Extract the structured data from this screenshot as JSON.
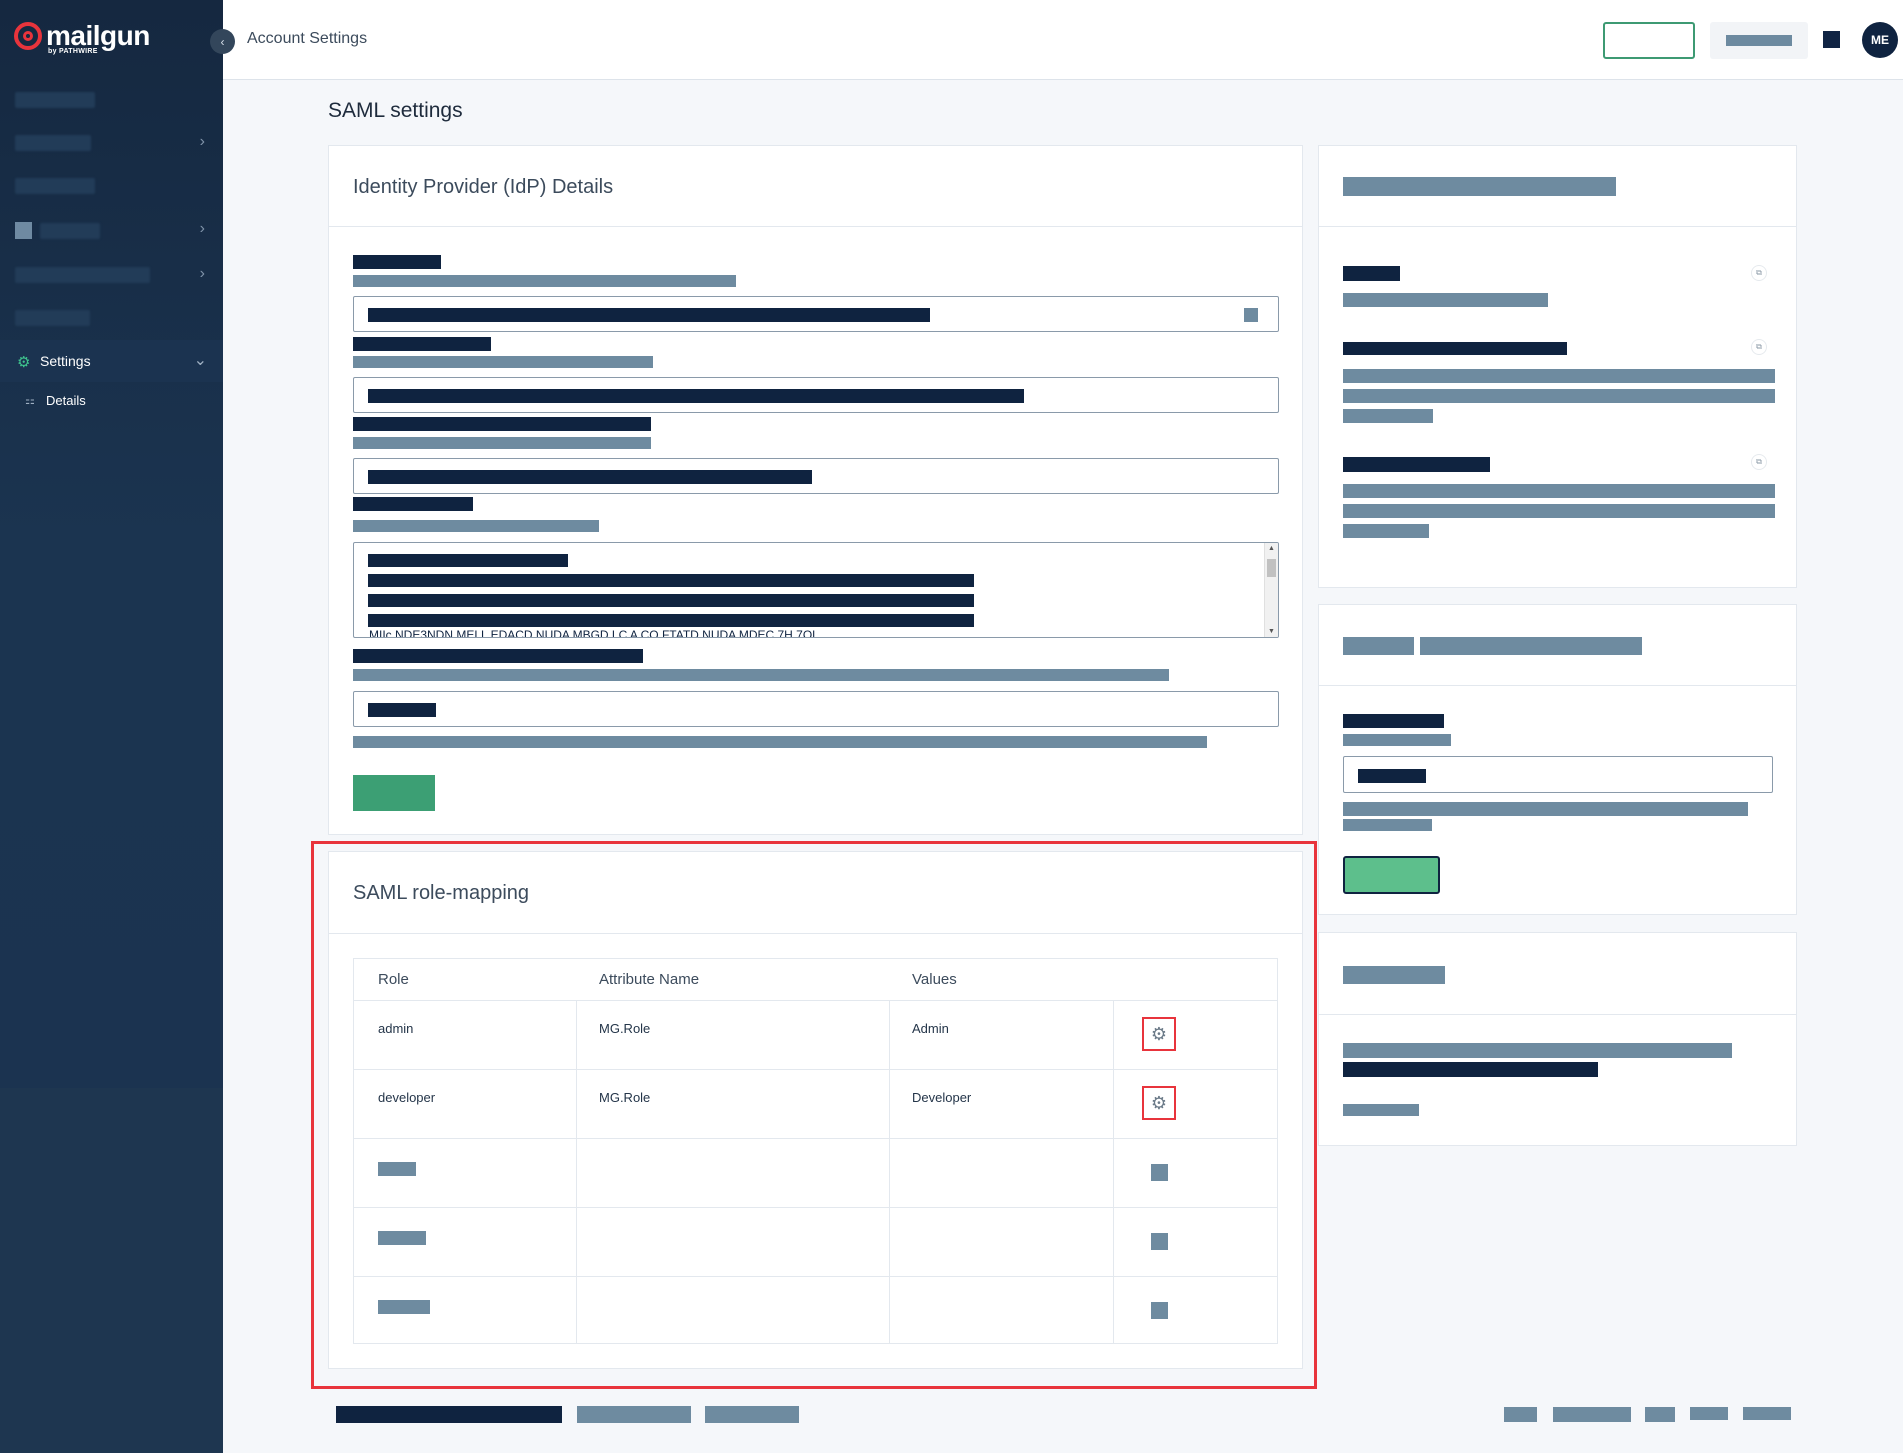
{
  "app": {
    "logo_text": "mailgun",
    "logo_sub": "by PATHWIRE"
  },
  "header": {
    "breadcrumb": "Account Settings",
    "avatar_initials": "ME"
  },
  "sidebar": {
    "settings_label": "Settings",
    "details_label": "Details"
  },
  "page": {
    "title": "SAML settings"
  },
  "idp_card": {
    "title": "Identity Provider (IdP) Details",
    "textarea_cut_text": "MIIc NDE3NDN MELL EDACD NUDA MBGD LC A CO FTATD NUDA MDEC 7H 7OL"
  },
  "role_mapping": {
    "title": "SAML role-mapping",
    "columns": [
      "Role",
      "Attribute Name",
      "Values"
    ],
    "rows": [
      {
        "role": "admin",
        "attribute": "MG.Role",
        "value": "Admin"
      },
      {
        "role": "developer",
        "attribute": "MG.Role",
        "value": "Developer"
      }
    ]
  },
  "icons": {
    "gear": "gear-icon",
    "copy": "copy-icon",
    "chevron": "chevron-right-icon"
  },
  "colors": {
    "sidebar": "#1e3650",
    "accent_green": "#3c9f74",
    "highlight_red": "#e8343c",
    "redacted_dark": "#0f2340",
    "redacted_grey": "#6e8ba0"
  }
}
